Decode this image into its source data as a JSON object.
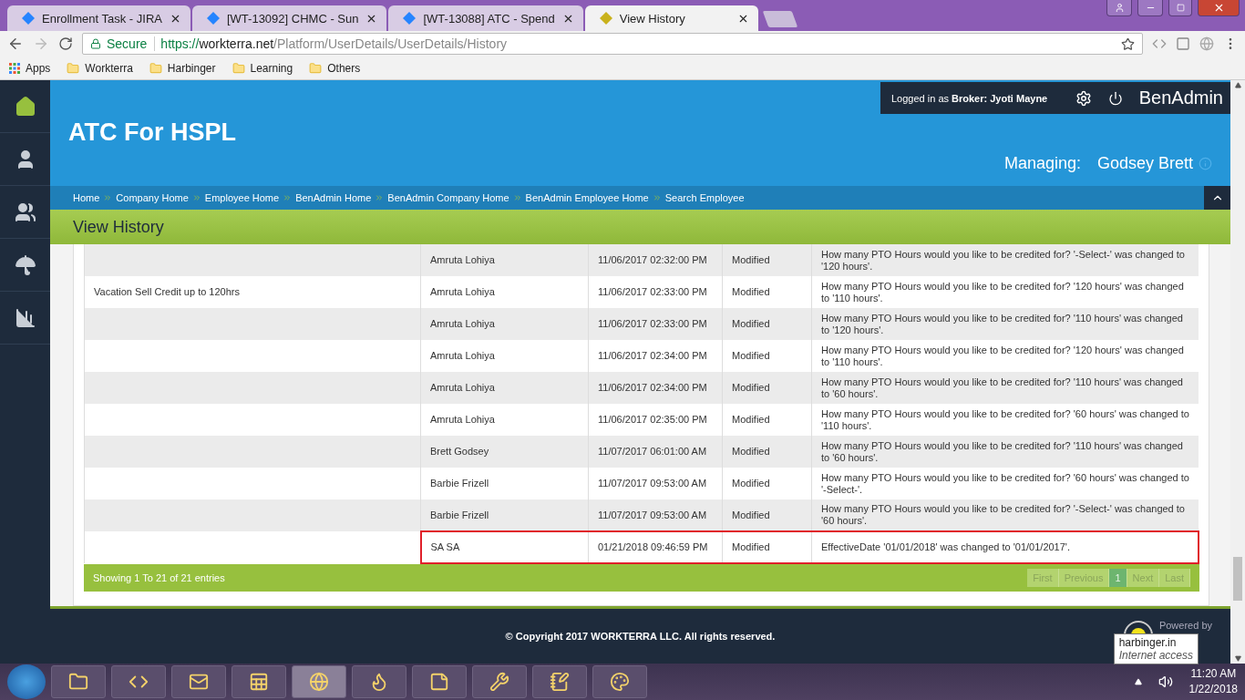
{
  "browser": {
    "tabs": [
      {
        "title": "Enrollment Task - JIRA",
        "selected": false
      },
      {
        "title": "[WT-13092] CHMC - Sun",
        "selected": false
      },
      {
        "title": "[WT-13088] ATC - Spend",
        "selected": false
      },
      {
        "title": "View History",
        "selected": true
      }
    ],
    "secure_label": "Secure",
    "url": {
      "scheme": "https://",
      "host": "workterra.net",
      "path": "/Platform/UserDetails/UserDetails/History"
    },
    "bookmarks": [
      {
        "label": "Apps",
        "kind": "apps"
      },
      {
        "label": "Workterra",
        "kind": "folder"
      },
      {
        "label": "Harbinger",
        "kind": "folder"
      },
      {
        "label": "Learning",
        "kind": "folder"
      },
      {
        "label": "Others",
        "kind": "folder"
      }
    ]
  },
  "sidebar": {
    "items": [
      {
        "kind": "home",
        "selected": true
      },
      {
        "kind": "person",
        "selected": false
      },
      {
        "kind": "people",
        "selected": false
      },
      {
        "kind": "benefits",
        "selected": false
      },
      {
        "kind": "reports",
        "selected": false
      }
    ]
  },
  "header": {
    "company": "ATC For HSPL",
    "login_prefix": "Logged in as",
    "login_role": "Broker:",
    "login_name": "Jyoti Mayne",
    "app_name": "BenAdmin",
    "managing_label": "Managing:",
    "managing_name": "Godsey Brett"
  },
  "breadcrumbs": [
    "Home",
    "Company Home",
    "Employee Home",
    "BenAdmin Home",
    "BenAdmin Company Home",
    "BenAdmin Employee Home",
    "Search Employee"
  ],
  "page_title": "View History",
  "table": {
    "rows": [
      {
        "item": "",
        "user": "Amruta Lohiya",
        "date": "11/06/2017 02:32:00 PM",
        "action": "Modified",
        "description": "How many PTO Hours would you like to be credited for? '-Select-' was changed to '120 hours'.",
        "highlighted": false
      },
      {
        "item": "Vacation Sell Credit up to 120hrs",
        "user": "Amruta Lohiya",
        "date": "11/06/2017 02:33:00 PM",
        "action": "Modified",
        "description": "How many PTO Hours would you like to be credited for? '120 hours' was changed to '110 hours'.",
        "highlighted": false
      },
      {
        "item": "",
        "user": "Amruta Lohiya",
        "date": "11/06/2017 02:33:00 PM",
        "action": "Modified",
        "description": "How many PTO Hours would you like to be credited for? '110 hours' was changed to '120 hours'.",
        "highlighted": false
      },
      {
        "item": "",
        "user": "Amruta Lohiya",
        "date": "11/06/2017 02:34:00 PM",
        "action": "Modified",
        "description": "How many PTO Hours would you like to be credited for? '120 hours' was changed to '110 hours'.",
        "highlighted": false
      },
      {
        "item": "",
        "user": "Amruta Lohiya",
        "date": "11/06/2017 02:34:00 PM",
        "action": "Modified",
        "description": "How many PTO Hours would you like to be credited for? '110 hours' was changed to '60 hours'.",
        "highlighted": false
      },
      {
        "item": "",
        "user": "Amruta Lohiya",
        "date": "11/06/2017 02:35:00 PM",
        "action": "Modified",
        "description": "How many PTO Hours would you like to be credited for? '60 hours' was changed to '110 hours'.",
        "highlighted": false
      },
      {
        "item": "",
        "user": "Brett Godsey",
        "date": "11/07/2017 06:01:00 AM",
        "action": "Modified",
        "description": "How many PTO Hours would you like to be credited for? '110 hours' was changed to '60 hours'.",
        "highlighted": false
      },
      {
        "item": "",
        "user": "Barbie Frizell",
        "date": "11/07/2017 09:53:00 AM",
        "action": "Modified",
        "description": "How many PTO Hours would you like to be credited for? '60 hours' was changed to '-Select-'.",
        "highlighted": false
      },
      {
        "item": "",
        "user": "Barbie Frizell",
        "date": "11/07/2017 09:53:00 AM",
        "action": "Modified",
        "description": "How many PTO Hours would you like to be credited for? '-Select-' was changed to '60 hours'.",
        "highlighted": false
      },
      {
        "item": "",
        "user": "SA SA",
        "date": "01/21/2018 09:46:59 PM",
        "action": "Modified",
        "description": "EffectiveDate '01/01/2018' was changed to '01/01/2017'.",
        "highlighted": true
      }
    ],
    "summary": "Showing 1 To 21 of 21 entries",
    "pagination": [
      {
        "label": "First",
        "selected": false
      },
      {
        "label": "Previous",
        "selected": false
      },
      {
        "label": "1",
        "selected": true
      },
      {
        "label": "Next",
        "selected": false
      },
      {
        "label": "Last",
        "selected": false
      }
    ]
  },
  "footer": {
    "copyright": "© Copyright 2017 WORKTERRA LLC. All rights reserved.",
    "powered_by": "Powered by"
  },
  "tooltip": {
    "title": "harbinger.in",
    "subtitle": "Internet access"
  },
  "taskbar": {
    "apps": [
      {
        "kind": "folder",
        "selected": false
      },
      {
        "kind": "code",
        "selected": false
      },
      {
        "kind": "mail",
        "selected": false
      },
      {
        "kind": "sheet",
        "selected": false
      },
      {
        "kind": "globe",
        "selected": true
      },
      {
        "kind": "flame",
        "selected": false
      },
      {
        "kind": "notes",
        "selected": false
      },
      {
        "kind": "tools",
        "selected": false
      },
      {
        "kind": "notepad",
        "selected": false
      },
      {
        "kind": "palette",
        "selected": false
      }
    ],
    "time": "11:20 AM",
    "date": "1/22/2018"
  }
}
